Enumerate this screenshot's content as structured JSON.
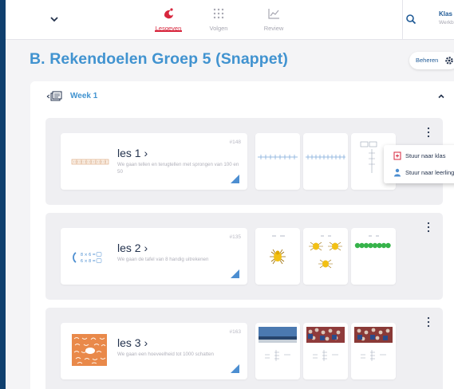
{
  "topnav": {
    "tabs": [
      {
        "label": "Lesgeven",
        "icon": "lesgeven-icon",
        "active": true
      },
      {
        "label": "Volgen",
        "icon": "grid-icon",
        "active": false
      },
      {
        "label": "Review",
        "icon": "chart-icon",
        "active": false
      }
    ],
    "class_label": "Klas",
    "class_sub": "Werkb"
  },
  "page": {
    "title": "B. Rekendoelen Groep 5 (Snappet)",
    "manage_label": "Beheren"
  },
  "week": {
    "label": "Week 1",
    "lessons": [
      {
        "title": "les 1 ›",
        "description": "We gaan tellen en terugtellen met sprongen van 100 en 50",
        "number": "#148"
      },
      {
        "title": "les 2 ›",
        "description": "We gaan de tafel van 8 handig uitrekenen",
        "number": "#135"
      },
      {
        "title": "les 3 ›",
        "description": "We gaan een hoeveelheid tot 1000 schatten",
        "number": "#163"
      }
    ]
  },
  "dropdown": {
    "items": [
      {
        "label": "Stuur naar klas",
        "icon": "send-class-icon"
      },
      {
        "label": "Stuur naar leerling",
        "icon": "person-icon"
      }
    ]
  },
  "colors": {
    "accent": "#d7263d",
    "title_blue": "#4193d0",
    "dark_text": "#23324d",
    "background": "#0f3f6e"
  }
}
